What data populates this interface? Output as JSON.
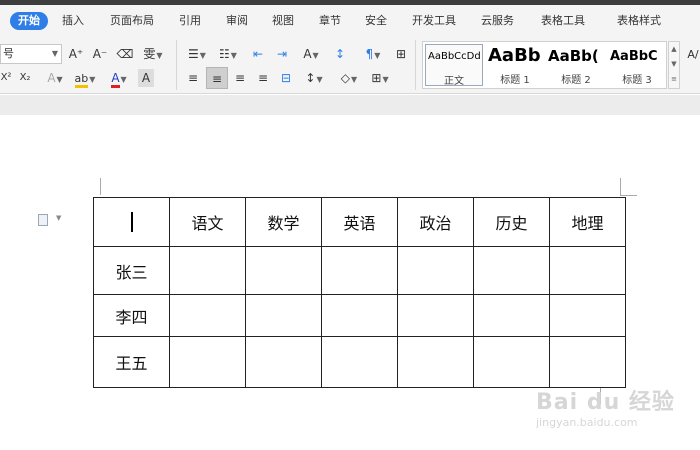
{
  "tabs": [
    "开始",
    "插入",
    "页面布局",
    "引用",
    "审阅",
    "视图",
    "章节",
    "安全",
    "开发工具",
    "云服务",
    "表格工具",
    "表格样式"
  ],
  "ribbon": {
    "font_size_value": "号",
    "font": {
      "grow_label": "A⁺",
      "shrink_label": "A⁻",
      "clear_label": "⌫",
      "phonetic_label": "雯",
      "superscript_label": "X²",
      "subscript_label": "X₂",
      "text_effect_label": "A",
      "highlight_label": "ab",
      "font_color_label": "A",
      "char_shade_label": "A"
    },
    "paragraph": {
      "bullets_label": "☰",
      "numbering_label": "☷",
      "outdent_label": "⇤",
      "indent_label": "⇥",
      "chinese_layout_label": "A",
      "sort_label": "↕",
      "show_marks_label": "¶",
      "border_label": "⊞",
      "align_left_label": "≡",
      "align_center_label": "≡",
      "align_right_label": "≡",
      "justify_label": "≡",
      "distribute_label": "⊟",
      "line_spacing_label": "↕",
      "shading_label": "◇",
      "borders_label": "⊞"
    },
    "styles": [
      {
        "sample": "AaBbCcDd",
        "name": "正文"
      },
      {
        "sample": "AaBb",
        "name": "标题 1"
      },
      {
        "sample": "AaBb(",
        "name": "标题 2"
      },
      {
        "sample": "AaBbC",
        "name": "标题 3"
      }
    ],
    "right_edge_label": "A/"
  },
  "table": {
    "header": [
      "",
      "语文",
      "数学",
      "英语",
      "政治",
      "历史",
      "地理"
    ],
    "rows": [
      [
        "张三",
        "",
        "",
        "",
        "",
        "",
        ""
      ],
      [
        "李四",
        "",
        "",
        "",
        "",
        "",
        ""
      ],
      [
        "王五",
        "",
        "",
        "",
        "",
        "",
        ""
      ]
    ]
  },
  "watermark": {
    "logo": "Bai du 经验",
    "url": "jingyan.baidu.com"
  },
  "colors": {
    "accent": "#2f7ee8",
    "font_color_underline": "#e02020",
    "highlight_underline": "#f2c200"
  }
}
